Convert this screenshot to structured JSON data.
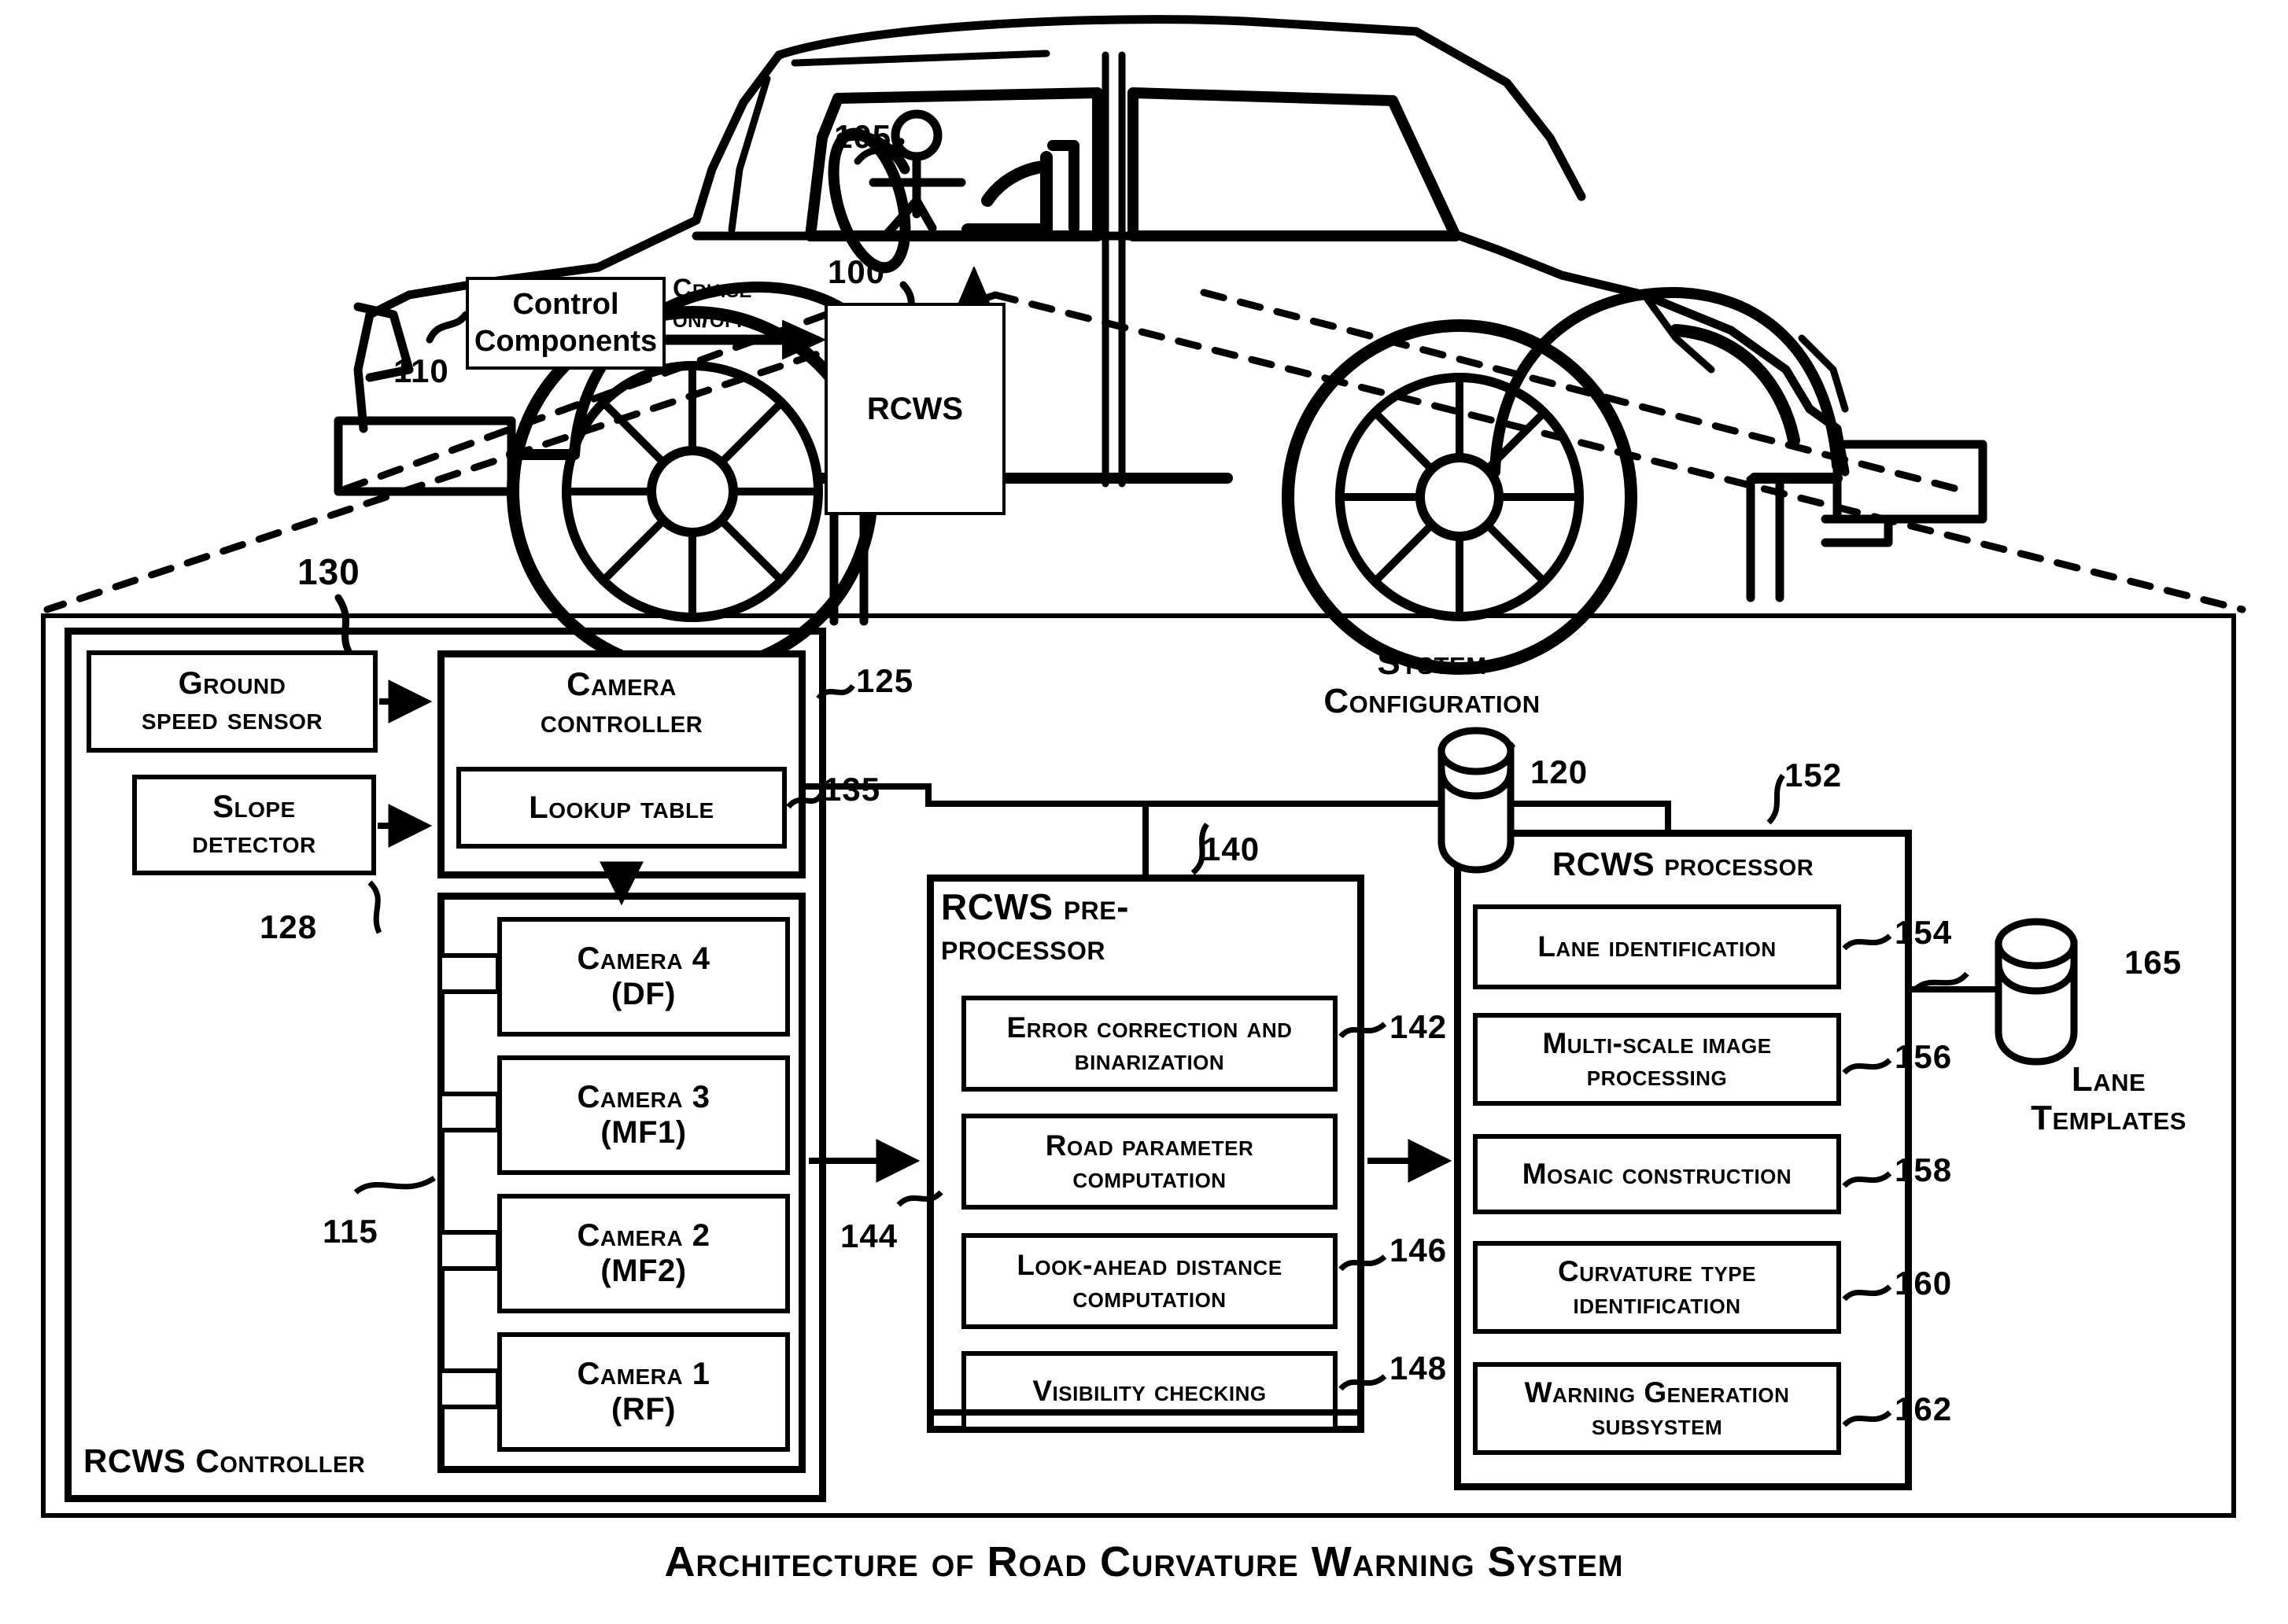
{
  "figure": {
    "caption": "Architecture of Road Curvature Warning System"
  },
  "vehicle": {
    "control_components_label": "Control Components",
    "cruise_label_line1": "Cruise",
    "cruise_label_line2": "on/off",
    "rcws_label": "RCWS",
    "refs": {
      "driver": "105",
      "rcws": "100",
      "control_components": "110",
      "expanded_view": "130"
    }
  },
  "controller": {
    "title": "RCWS Controller",
    "ground_speed_sensor": {
      "line1": "Ground",
      "line2": "speed sensor"
    },
    "slope_detector": {
      "line1": "Slope",
      "line2": "detector",
      "ref": "128"
    },
    "camera_controller": {
      "line1": "Camera",
      "line2": "controller",
      "ref": "125",
      "lookup_table": "Lookup table",
      "lookup_table_ref": "135"
    },
    "camera_group_ref": "115",
    "cameras": [
      {
        "name": "Camera 4",
        "type": "(DF)"
      },
      {
        "name": "Camera 3",
        "type": "(MF1)"
      },
      {
        "name": "Camera 2",
        "type": "(MF2)"
      },
      {
        "name": "Camera 1",
        "type": "(RF)"
      }
    ]
  },
  "system_configuration": {
    "label_line1": "System",
    "label_line2": "Configuration",
    "ref": "120"
  },
  "preprocessor": {
    "title_line1": "RCWS pre-",
    "title_line2": "processor",
    "ref": "140",
    "input_ref": "144",
    "modules": [
      {
        "line1": "Error correction and",
        "line2": "binarization",
        "ref": "142"
      },
      {
        "line1": "Road parameter",
        "line2": "computation",
        "ref": ""
      },
      {
        "line1": "Look-ahead distance",
        "line2": "computation",
        "ref": "146"
      },
      {
        "line1": "Visibility checking",
        "line2": "",
        "ref": "148"
      }
    ]
  },
  "processor": {
    "title": "RCWS processor",
    "ref": "152",
    "modules": [
      {
        "line1": "Lane identification",
        "line2": "",
        "ref": "154"
      },
      {
        "line1": "Multi-scale image",
        "line2": "processing",
        "ref": "156"
      },
      {
        "line1": "Mosaic construction",
        "line2": "",
        "ref": "158"
      },
      {
        "line1": "Curvature type",
        "line2": "identification",
        "ref": "160"
      },
      {
        "line1": "Warning Generation",
        "line2": "subsystem",
        "ref": "162"
      }
    ]
  },
  "lane_templates": {
    "label_line1": "Lane",
    "label_line2": "Templates",
    "ref": "165"
  },
  "colors": {
    "ink": "#000000",
    "paper": "#ffffff"
  }
}
